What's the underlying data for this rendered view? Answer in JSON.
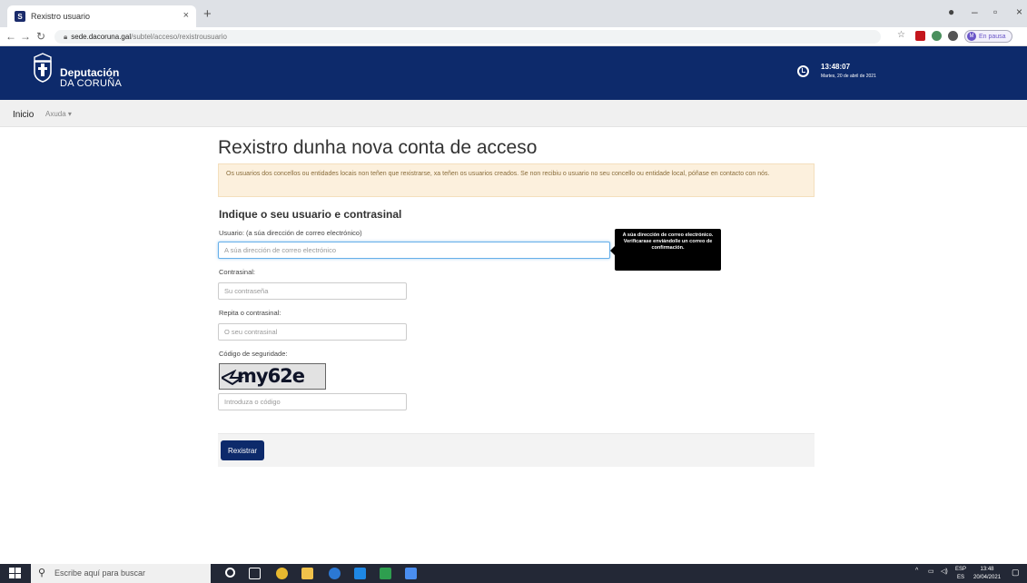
{
  "browser": {
    "tab_title": "Rexistro usuario",
    "favicon_letter": "S",
    "new_tab": "+",
    "close_tab": "×",
    "url_host": "sede.dacoruna.gal",
    "url_path": "/subtel/acceso/rexistrousuario",
    "profile_initial": "M",
    "profile_status": "En pausa"
  },
  "header": {
    "logo_line1": "Deputación",
    "logo_line2": "DA CORUÑA",
    "time": "13:48:07",
    "date": "Martes, 20 de abril de 2021"
  },
  "menu": {
    "inicio": "Inicio",
    "axuda": "Axuda ▾"
  },
  "page": {
    "title": "Rexistro dunha nova conta de acceso",
    "alert": "Os usuarios dos concellos ou entidades locais non teñen que rexistrarse, xa teñen os usuarios creados. Se non recibiu o usuario no seu concello ou entidade local, póñase en contacto con nós.",
    "section_title": "Indique o seu usuario e contrasinal",
    "usuario_label": "Usuario: (a súa dirección de correo electrónico)",
    "usuario_placeholder": "A súa dirección de correo electrónico",
    "tooltip": "A súa dirección de correo electrónico. Verificarase enviándolle un correo de confirmación.",
    "contrasinal_label": "Contrasinal:",
    "contrasinal_placeholder": "Su contraseña",
    "repita_label": "Repita o contrasinal:",
    "repita_placeholder": "O seu contrasinal",
    "codigo_label": "Código de seguridade:",
    "captcha_text": "my62e",
    "codigo_placeholder": "Introduza o código",
    "submit_label": "Rexistrar"
  },
  "taskbar": {
    "search_placeholder": "Escribe aquí para buscar",
    "lang_top": "ESP",
    "lang_bottom": "ES",
    "clock_time": "13:48",
    "clock_date": "20/04/2021"
  },
  "colors": {
    "brand": "#0d2a6b",
    "alert_bg": "#fcf0dd",
    "alert_text": "#8a6d3b"
  }
}
